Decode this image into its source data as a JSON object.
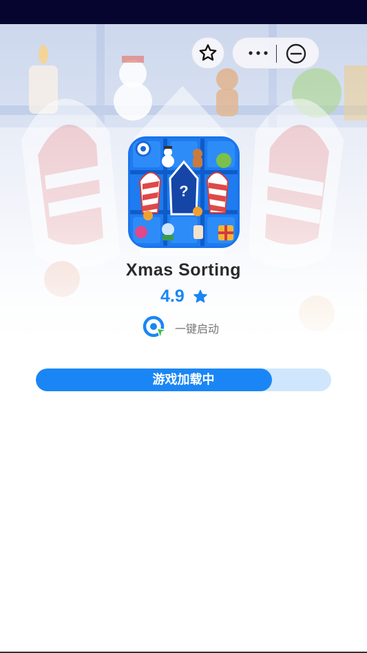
{
  "app": {
    "name": "Xmas Sorting",
    "rating": "4.9",
    "quick_launch_label": "一键启动"
  },
  "loading": {
    "label": "游戏加载中",
    "progress_fraction": 0.8
  },
  "icons": {
    "favorite": "star-outline-icon",
    "more": "more-dots-icon",
    "close": "minus-circle-icon",
    "rating": "star-filled-icon",
    "quick_launch": "quick-launch-icon"
  },
  "colors": {
    "accent": "#1A86F5",
    "progress_track": "#CFE6FD",
    "status_bar": "#050530",
    "title": "#2b2b2b"
  }
}
